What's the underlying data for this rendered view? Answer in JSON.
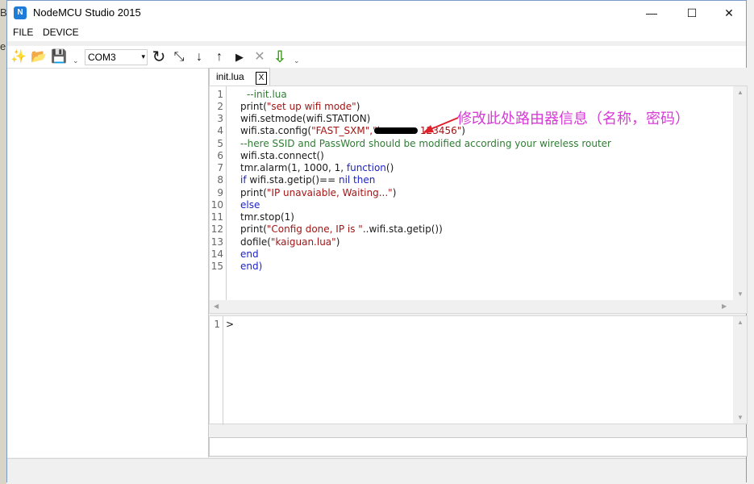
{
  "window": {
    "title": "NodeMCU Studio 2015",
    "icon_text": "N",
    "minimize_glyph": "—",
    "maximize_glyph": "☐",
    "close_glyph": "✕"
  },
  "desktop": {
    "edge_glyph_1": "B",
    "edge_glyph_2": "el"
  },
  "menu": {
    "file": "FILE",
    "device": "DEVICE"
  },
  "toolbar": {
    "new_icon": "✨",
    "open_icon": "📂",
    "save_icon": "💾",
    "grip": "⌄",
    "port": {
      "value": "COM3",
      "arrow": "▾"
    },
    "refresh_icon": "↻",
    "connect_icon": "⤡",
    "download_icon": "↓",
    "upload_icon": "↑",
    "run_icon": "▶",
    "stop_icon": "✕",
    "flash_icon": "⇩"
  },
  "tab": {
    "label": "init.lua",
    "close": "X"
  },
  "editor": {
    "line_numbers": [
      "1",
      "2",
      "3",
      "4",
      "5",
      "6",
      "7",
      "8",
      "9",
      "10",
      "11",
      "12",
      "13",
      "14",
      "15"
    ],
    "lines": {
      "l1": "--init.lua",
      "l2a": "print(",
      "l2b": "\"set up wifi mode\"",
      "l2c": ")",
      "l3": "wifi.setmode(wifi.STATION)",
      "l4a": "wifi.sta.config(",
      "l4b": "\"FAST_SXM\",\"l",
      "l4c": "123456\"",
      "l4d": ")",
      "l5": "--here SSID and PassWord should be modified according your wireless router",
      "l6": "wifi.sta.connect()",
      "l7a": "tmr.alarm(1, 1000, 1, ",
      "l7b": "function",
      "l7c": "()",
      "l8a": "if",
      "l8b": " wifi.sta.getip()== ",
      "l8c": "nil then",
      "l9a": "print(",
      "l9b": "\"IP unavaiable, Waiting...\"",
      "l9c": ")",
      "l10": "else",
      "l11": "tmr.stop(1)",
      "l12a": "print(",
      "l12b": "\"Config done, IP is \"",
      "l12c": "..wifi.sta.getip())",
      "l13a": "dofile(",
      "l13b": "\"kaiguan.lua\"",
      "l13c": ")",
      "l14": "end",
      "l15": "end)"
    },
    "annotation": "修改此处路由器信息（名称，密码）",
    "annotation_color": "#d63bd6"
  },
  "console": {
    "line_number": "1",
    "prompt": ">"
  },
  "scrollbar": {
    "up": "▲",
    "down": "▼",
    "left": "◀",
    "right": "▶"
  }
}
